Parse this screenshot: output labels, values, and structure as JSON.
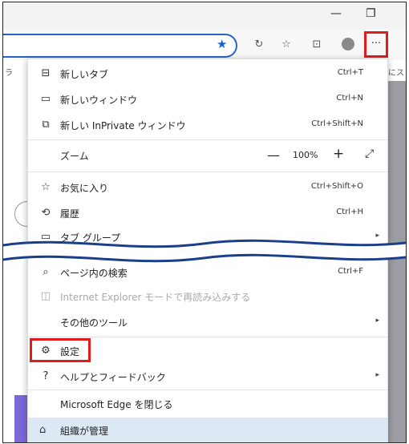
{
  "window": {
    "minimize_glyph": "—",
    "restore_glyph": "❐"
  },
  "toolbar": {
    "favorite_icon": "star-filled-icon",
    "more_label": "···",
    "tab_text_left": "ラ",
    "tab_text_right": "にス"
  },
  "menu": {
    "new_tab": {
      "label": "新しいタブ",
      "shortcut": "Ctrl+T"
    },
    "new_window": {
      "label": "新しいウィンドウ",
      "shortcut": "Ctrl+N"
    },
    "new_inprivate": {
      "label": "新しい InPrivate ウィンドウ",
      "shortcut": "Ctrl+Shift+N"
    },
    "zoom": {
      "label": "ズーム",
      "minus": "—",
      "value": "100%",
      "plus": "+",
      "fullscreen": "⤢"
    },
    "favorites": {
      "label": "お気に入り",
      "shortcut": "Ctrl+Shift+O"
    },
    "history": {
      "label": "履歴",
      "shortcut": "Ctrl+H"
    },
    "tab_groups": {
      "label": "タブ グループ"
    },
    "find": {
      "label": "ページ内の検索",
      "shortcut": "Ctrl+F"
    },
    "ie_mode": {
      "label": "Internet Explorer モードで再読み込みする"
    },
    "more_tools": {
      "label": "その他のツール"
    },
    "settings": {
      "label": "設定"
    },
    "help": {
      "label": "ヘルプとフィードバック"
    },
    "close_edge": {
      "label": "Microsoft Edge を閉じる"
    },
    "managed": {
      "label": "組織が管理"
    }
  },
  "colors": {
    "highlight": "#e21c1c",
    "accent": "#2563c9",
    "managed_bg": "#dde8f5"
  }
}
